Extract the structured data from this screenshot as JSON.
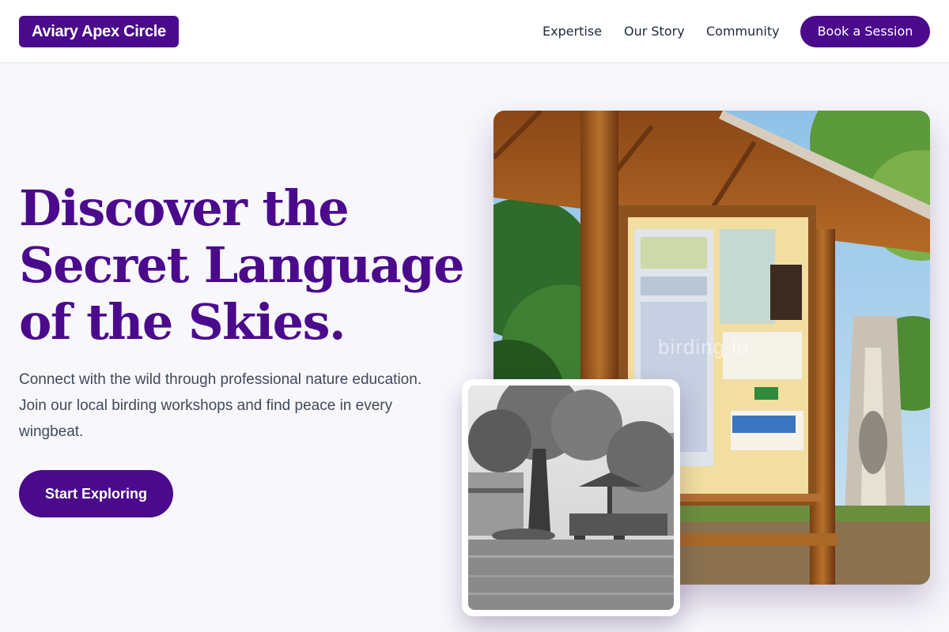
{
  "header": {
    "logo": "Aviary Apex Circle",
    "nav": [
      "Expertise",
      "Our Story",
      "Community"
    ],
    "cta_label": "Book a Session"
  },
  "hero": {
    "title_lines": [
      "Discover the",
      "Secret Language",
      "of the Skies."
    ],
    "description": "Connect with the wild through professional nature education. Join our local birding workshops and find peace in every wingbeat.",
    "button_label": "Start Exploring"
  },
  "images": {
    "main_watermark": "birding lo"
  },
  "colors": {
    "brand": "#4b0a8c",
    "background": "#f8f7fc",
    "text_body": "#3f4a5a"
  }
}
